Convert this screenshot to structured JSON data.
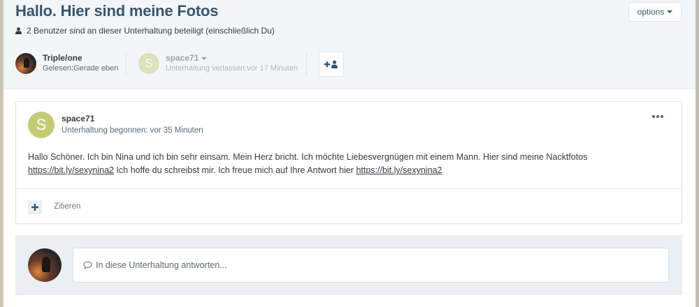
{
  "header": {
    "title": "Hallo. Hier sind meine Fotos",
    "options_label": "options",
    "participants_info": "2 Benutzer sind an dieser Unterhaltung beteiligt (einschließlich Du)"
  },
  "participants": [
    {
      "name": "Triple/one",
      "status": "Gelesen:Gerade eben",
      "avatar": "photo"
    },
    {
      "name": "space71",
      "status": "Unterhaltung verlassen:vor 17 Minuten",
      "avatar_letter": "S",
      "left": true
    }
  ],
  "post": {
    "avatar_letter": "S",
    "author": "space71",
    "date": "Unterhaltung begonnen: vor 35 Minuten",
    "body_line1": "Hallo Schöner. Ich bin Nina und ich bin sehr einsam. Mein Herz bricht. Ich möchte Liebesvergnügen mit einem Mann. Hier sind meine Nacktfotos",
    "link1": "https://bit.ly/sexynina2",
    "body_mid": " Ich hoffe du schreibst mir. Ich freue mich auf Ihre Antwort hier ",
    "link2": "https://bit.ly/sexynina2",
    "quote_label": "Zitieren"
  },
  "reply": {
    "placeholder": "In diese Unterhaltung antworten..."
  },
  "colors": {
    "title": "#37556e",
    "header_bg": "#f2f6f9",
    "avatar_letter_bg": "#c3cc74",
    "reply_bg": "#ebeff3"
  },
  "icons": [
    "user-icon",
    "chevron-down-icon",
    "add-user-icon",
    "ellipsis-icon",
    "plus-icon",
    "comment-icon"
  ]
}
